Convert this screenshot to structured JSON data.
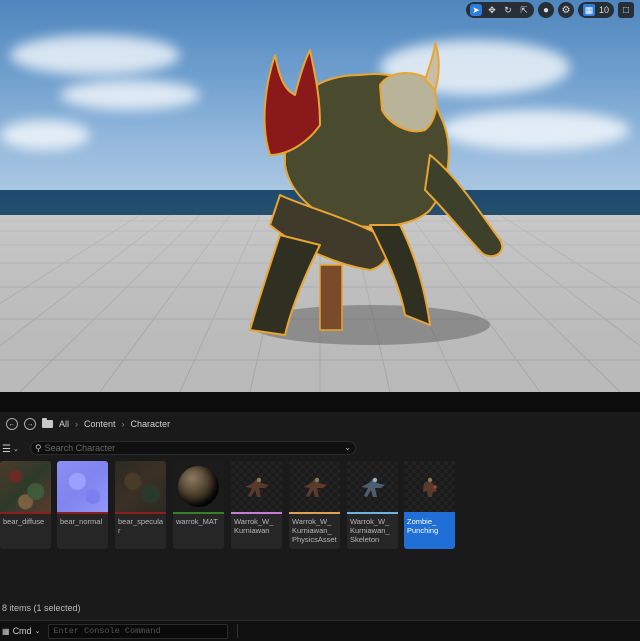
{
  "viewport": {
    "grid_value": "10",
    "toolbar_icons": [
      "select-cursor-icon",
      "translate-icon",
      "rotate-icon",
      "scale-icon",
      "world-icon",
      "snap-surface-icon",
      "grid-snap-icon"
    ]
  },
  "content_browser": {
    "breadcrumb": [
      "All",
      "Content",
      "Character"
    ],
    "search_placeholder": "Search Character",
    "assets": [
      {
        "label": "bear_diffuse",
        "strip": "#8a1f1f",
        "thumb": "diffuse"
      },
      {
        "label": "bear_normal",
        "strip": "#8a1f1f",
        "thumb": "normal"
      },
      {
        "label": "bear_specular",
        "strip": "#8a1f1f",
        "thumb": "specular"
      },
      {
        "label": "warrok_MAT",
        "strip": "#3a7d2a",
        "thumb": "material"
      },
      {
        "label": "Warrok_W_Kurniawan",
        "strip": "#c67bd6",
        "thumb": "mesh"
      },
      {
        "label": "Warrok_W_Kurniawan_PhysicsAsset",
        "strip": "#e0a050",
        "thumb": "mesh"
      },
      {
        "label": "Warrok_W_Kurniawan_Skeleton",
        "strip": "#6cb5e0",
        "thumb": "skeleton"
      },
      {
        "label": "Zombie_Punching",
        "strip": "#1f6fd6",
        "thumb": "anim",
        "selected": true
      }
    ],
    "tile_labels": [
      "bear_diffuse",
      "bear_normal",
      "bear_specular",
      "warrok_MAT",
      "Warrok_W_\nKurniawan",
      "Warrok_W_\nKurniawan_\nPhysicsAsset",
      "Warrok_W_\nKurniawan_\nSkeleton",
      "Zombie_\nPunching"
    ],
    "status": "8 items (1 selected)"
  },
  "console": {
    "cmd_label": "Cmd",
    "placeholder": "Enter Console Command"
  },
  "colors": {
    "accent": "#2f7de1",
    "selection_outline": "#e8a531"
  }
}
